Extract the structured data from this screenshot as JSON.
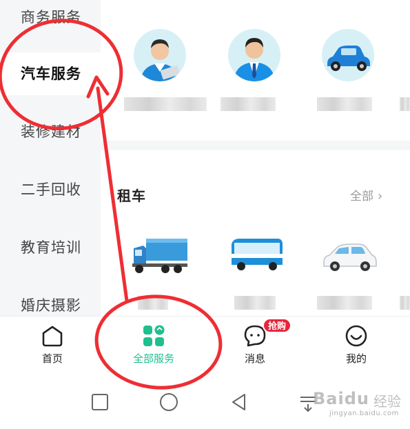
{
  "sidebar": {
    "items": [
      {
        "label": "商务服务"
      },
      {
        "label": "汽车服务"
      },
      {
        "label": "装修建材"
      },
      {
        "label": "二手回收"
      },
      {
        "label": "教育培训"
      },
      {
        "label": "婚庆摄影"
      }
    ],
    "active_index": 1
  },
  "main": {
    "section_title": "租车",
    "more_label": "全部",
    "top_icons": [
      "mechanic-avatar",
      "salesman-avatar",
      "vintage-car-icon"
    ],
    "vehicle_icons": [
      "truck-icon",
      "bus-icon",
      "sedan-icon"
    ]
  },
  "tabbar": {
    "tabs": [
      {
        "label": "首页",
        "icon": "home-icon"
      },
      {
        "label": "全部服务",
        "icon": "all-services-icon"
      },
      {
        "label": "消息",
        "icon": "message-icon"
      },
      {
        "label": "我的",
        "icon": "profile-icon"
      }
    ],
    "active_index": 1,
    "badge_text": "抢购"
  },
  "navbar": {
    "buttons": [
      "recents-button",
      "home-button",
      "back-button",
      "menu-button"
    ]
  },
  "watermark": {
    "text": "经验",
    "logo": "Baidu",
    "url": "jingyan.baidu.com"
  },
  "colors": {
    "accent": "#1fbf8f",
    "annotation": "#ee2e33",
    "badge": "#e8243a",
    "sidebar_bg": "#f5f6f7"
  }
}
